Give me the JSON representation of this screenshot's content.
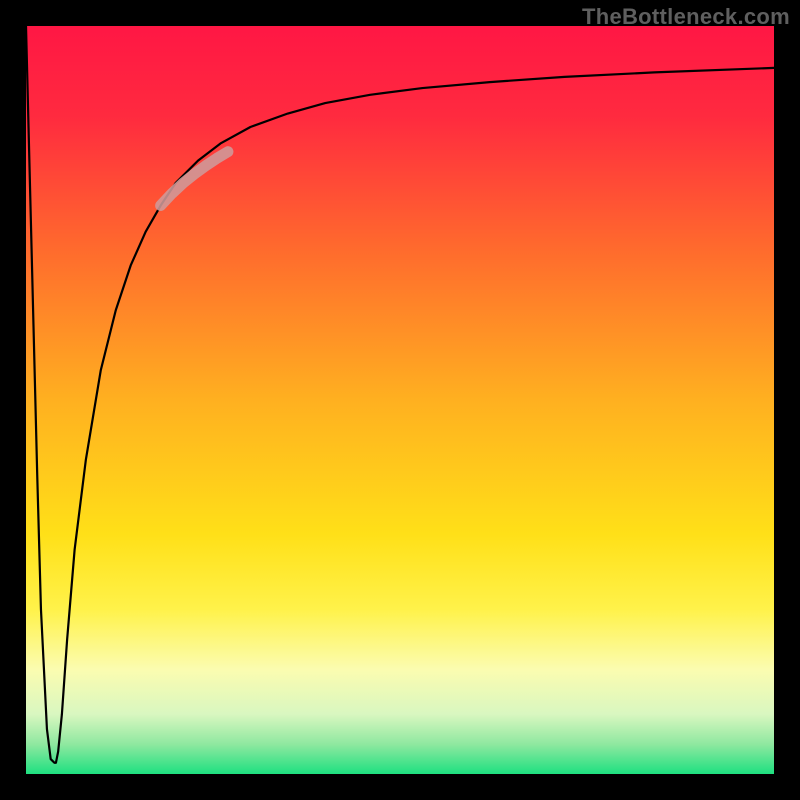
{
  "watermark": "TheBottleneck.com",
  "chart_data": {
    "type": "line",
    "title": "",
    "xlabel": "",
    "ylabel": "",
    "xlim": [
      0,
      100
    ],
    "ylim": [
      0,
      100
    ],
    "grid": false,
    "legend": false,
    "background_gradient": {
      "stops": [
        {
          "offset": 0.0,
          "color": "#ff1744"
        },
        {
          "offset": 0.12,
          "color": "#ff2a3f"
        },
        {
          "offset": 0.3,
          "color": "#ff6b2d"
        },
        {
          "offset": 0.5,
          "color": "#ffb020"
        },
        {
          "offset": 0.68,
          "color": "#ffe018"
        },
        {
          "offset": 0.78,
          "color": "#fff24a"
        },
        {
          "offset": 0.86,
          "color": "#fbfcb0"
        },
        {
          "offset": 0.92,
          "color": "#d9f7c0"
        },
        {
          "offset": 0.96,
          "color": "#8fe8a0"
        },
        {
          "offset": 1.0,
          "color": "#1ee080"
        }
      ]
    },
    "series": [
      {
        "name": "bottleneck-curve",
        "color": "#000000",
        "width": 2.2,
        "x": [
          0.0,
          0.2,
          0.5,
          1.0,
          1.5,
          2.0,
          2.8,
          3.3,
          3.8,
          4.0,
          4.3,
          4.8,
          5.5,
          6.5,
          8.0,
          10.0,
          12.0,
          14.0,
          16.0,
          18.0,
          20.0,
          23.0,
          26.0,
          30.0,
          35.0,
          40.0,
          46.0,
          53.0,
          62.0,
          72.0,
          84.0,
          100.0
        ],
        "values": [
          100.0,
          92.0,
          80.0,
          60.0,
          40.0,
          22.0,
          6.0,
          2.0,
          1.5,
          1.5,
          3.0,
          8.0,
          18.0,
          30.0,
          42.0,
          54.0,
          62.0,
          68.0,
          72.5,
          76.0,
          79.0,
          82.0,
          84.3,
          86.5,
          88.3,
          89.7,
          90.8,
          91.7,
          92.5,
          93.2,
          93.8,
          94.4
        ]
      },
      {
        "name": "highlight-segment",
        "color": "#cf9a9a",
        "opacity": 0.88,
        "width": 11,
        "x": [
          18.0,
          19.5,
          21.0,
          22.5,
          24.0,
          25.5,
          27.0
        ],
        "values": [
          76.0,
          77.6,
          79.0,
          80.2,
          81.3,
          82.3,
          83.2
        ]
      }
    ]
  }
}
